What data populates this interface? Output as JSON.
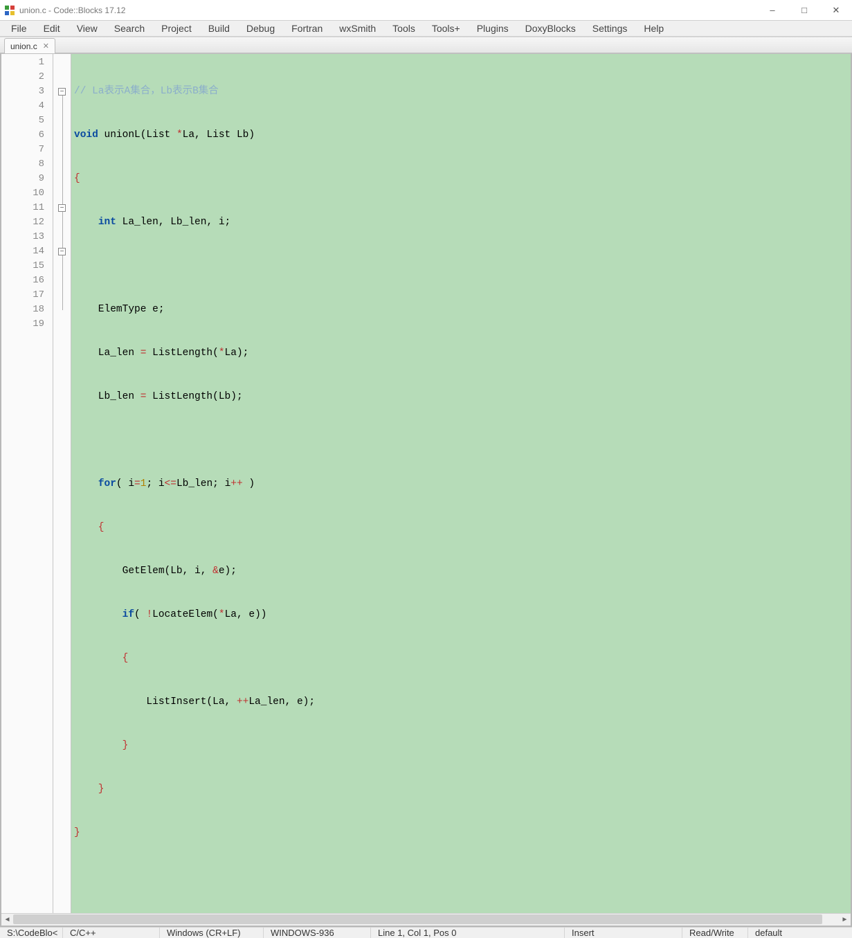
{
  "window": {
    "title": "union.c - Code::Blocks 17.12"
  },
  "menu": {
    "items": [
      "File",
      "Edit",
      "View",
      "Search",
      "Project",
      "Build",
      "Debug",
      "Fortran",
      "wxSmith",
      "Tools",
      "Tools+",
      "Plugins",
      "DoxyBlocks",
      "Settings",
      "Help"
    ]
  },
  "tab": {
    "label": "union.c"
  },
  "gutter": {
    "lines": [
      "1",
      "2",
      "3",
      "4",
      "5",
      "6",
      "7",
      "8",
      "9",
      "10",
      "11",
      "12",
      "13",
      "14",
      "15",
      "16",
      "17",
      "18",
      "19"
    ]
  },
  "code": {
    "line1_comment": "// La表示A集合，Lb表示B集合",
    "line2_void": "void",
    "line2_rest1": " unionL(List ",
    "line2_star": "*",
    "line2_rest2": "La, List Lb)",
    "line3": "{",
    "line4_int": "int",
    "line4_rest": " La_len, Lb_len, i;",
    "line6": "    ElemType e;",
    "line7a": "    La_len ",
    "line7_eq": "=",
    "line7b": " ListLength(",
    "line7_star": "*",
    "line7c": "La);",
    "line8a": "    Lb_len ",
    "line8_eq": "=",
    "line8b": " ListLength(Lb);",
    "line10_for": "for",
    "line10a": "( i",
    "line10_eq": "=",
    "line10_one": "1",
    "line10b": "; i",
    "line10_le": "<=",
    "line10c": "Lb_len; i",
    "line10_pp": "++",
    "line10d": " )",
    "line11": "    {",
    "line12a": "        GetElem(Lb, i, ",
    "line12_amp": "&",
    "line12b": "e);",
    "line13_if": "if",
    "line13a": "( ",
    "line13_not": "!",
    "line13b": "LocateElem(",
    "line13_star": "*",
    "line13c": "La, e))",
    "line14": "        {",
    "line15a": "            ListInsert(La, ",
    "line15_pp": "++",
    "line15b": "La_len, e);",
    "line16": "        }",
    "line17": "    }",
    "line18": "}"
  },
  "statusbar": {
    "path": "S:\\CodeBlo<",
    "language": "C/C++",
    "eol": "Windows (CR+LF)",
    "encoding": "WINDOWS-936",
    "position": "Line 1, Col 1, Pos 0",
    "insert_mode": "Insert",
    "readwrite": "Read/Write",
    "profile": "default"
  }
}
